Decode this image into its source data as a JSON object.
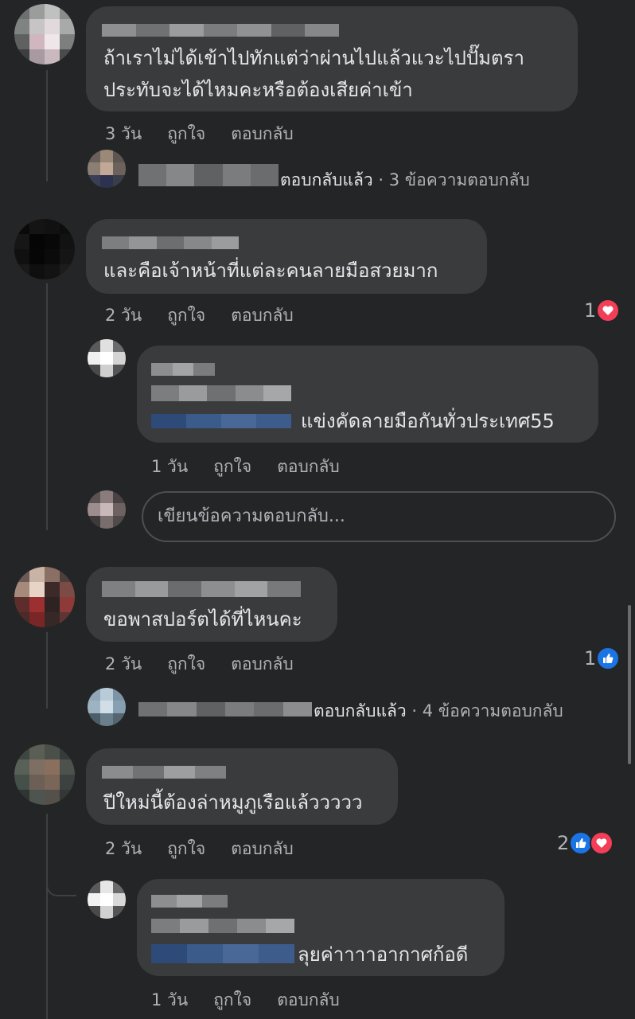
{
  "comments": [
    {
      "lines": [
        "ถ้าเราไม่ได้เข้าไปทักแต่ว่าผ่านไปแล้วแวะไปปั๊มตรา",
        "ประทับจะได้ไหมคะหรือต้องเสียค่าเข้า"
      ],
      "time": "3 วัน",
      "like": "ถูกใจ",
      "reply": "ตอบกลับ",
      "replied_label": "ตอบกลับแล้ว",
      "reply_count": " · 3 ข้อความตอบกลับ"
    },
    {
      "lines": [
        "และคือเจ้าหน้าที่แต่ละคนลายมือสวยมาก"
      ],
      "time": "2 วัน",
      "like": "ถูกใจ",
      "reply": "ตอบกลับ",
      "reaction_count": "1",
      "reactions": [
        "heart-icon"
      ]
    },
    {
      "lines": [
        "ขอพาสปอร์ตได้ที่ไหนคะ"
      ],
      "time": "2 วัน",
      "like": "ถูกใจ",
      "reply": "ตอบกลับ",
      "reaction_count": "1",
      "reactions": [
        "like-icon"
      ],
      "replied_label": "ตอบกลับแล้ว",
      "reply_count": " · 4 ข้อความตอบกลับ"
    },
    {
      "lines": [
        "ปีใหม่นี้ต้องล่าหมูภูเรือแล้ววววว"
      ],
      "time": "2 วัน",
      "like": "ถูกใจ",
      "reply": "ตอบกลับ",
      "reaction_count": "2",
      "reactions": [
        "like-icon",
        "heart-icon"
      ]
    }
  ],
  "replies": [
    {
      "text": "แข่งคัดลายมือกันทั่วประเทศ55",
      "time": "1 วัน",
      "like": "ถูกใจ",
      "reply": "ตอบกลับ"
    },
    {
      "text": "ลุยค่าาาาอากาศก้อดี",
      "time": "1 วัน",
      "like": "ถูกใจ",
      "reply": "ตอบกลับ"
    }
  ],
  "reply_input": {
    "placeholder": "เขียนข้อความตอบกลับ..."
  },
  "colors": {
    "background": "#242526",
    "bubble": "#3a3b3c",
    "heart": "#f33e58",
    "like": "#1b74e4",
    "mention": "#3b5b8a"
  }
}
